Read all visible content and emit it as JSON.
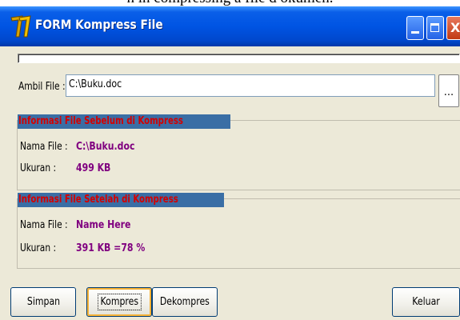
{
  "caption": "n in compressing a file d okumen.",
  "window": {
    "title": "FORM Kompress File",
    "progress_percent": 0
  },
  "file": {
    "label": "Ambil File :",
    "value": "C:\\Buku.doc",
    "browse_label": "..."
  },
  "before": {
    "title": "Informasi File Sebelum di Kompress",
    "name_label": "Nama File :",
    "name_value": "C:\\Buku.doc",
    "size_label": "Ukuran :",
    "size_value": "499 KB"
  },
  "after": {
    "title": "Informasi File Setelah di Kompress",
    "name_label": "Nama File :",
    "name_value": "Name Here",
    "size_label": "Ukuran :",
    "size_value": "391 KB =78 %"
  },
  "buttons": {
    "save": "Simpan",
    "compress": "Kompres",
    "decompress": "Dekompres",
    "exit": "Keluar"
  },
  "colors": {
    "title_bar": "#0054e3",
    "section_title_bg": "#3a6ea5",
    "section_title_text": "#d40000",
    "value_text": "#800080"
  }
}
